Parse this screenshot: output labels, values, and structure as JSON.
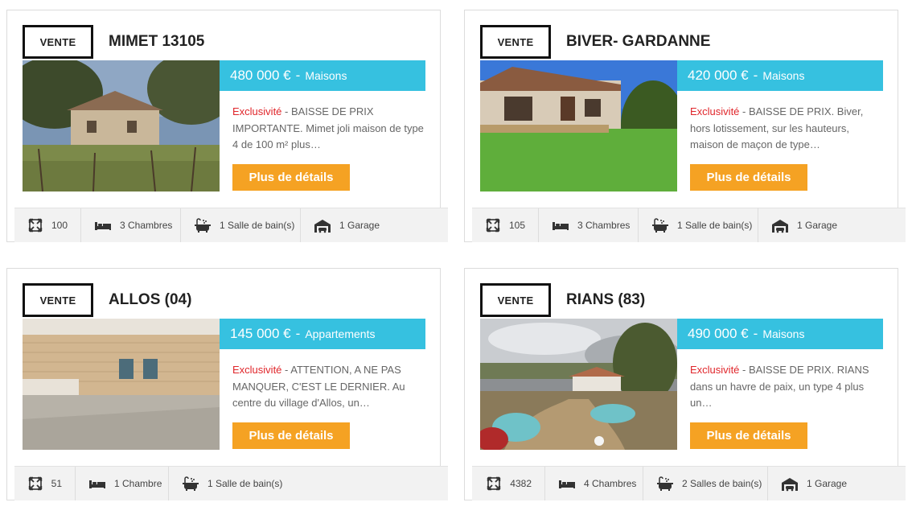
{
  "colors": {
    "accent_blue": "#36c1e0",
    "button_orange": "#f5a223",
    "exclusive_red": "#e0262b"
  },
  "listings": [
    {
      "badge": "VENTE",
      "title": "MIMET 13105",
      "price": "480 000 €",
      "separator": "-",
      "property_type": "Maisons",
      "exclusive_label": "Exclusivité",
      "description": " - BAISSE DE PRIX IMPORTANTE. Mimet joli maison de type 4 de 100 m² plus…",
      "button_label": "Plus de détails",
      "features": {
        "surface": "100",
        "bedrooms": "3 Chambres",
        "bathrooms": "1 Salle de bain(s)",
        "garage": "1 Garage"
      }
    },
    {
      "badge": "VENTE",
      "title": "BIVER- GARDANNE",
      "price": "420 000 €",
      "separator": "-",
      "property_type": "Maisons",
      "exclusive_label": "Exclusivité",
      "description": " - BAISSE DE PRIX. Biver, hors lotissement, sur les hauteurs, maison de maçon de type…",
      "button_label": "Plus de détails",
      "features": {
        "surface": "105",
        "bedrooms": "3 Chambres",
        "bathrooms": "1 Salle de bain(s)",
        "garage": "1 Garage"
      }
    },
    {
      "badge": "VENTE",
      "title": "ALLOS (04)",
      "price": "145 000 €",
      "separator": "-",
      "property_type": "Appartements",
      "exclusive_label": "Exclusivité",
      "description": " - ATTENTION, A NE PAS MANQUER, C'EST LE DERNIER. Au centre du village d'Allos, un…",
      "button_label": "Plus de détails",
      "features": {
        "surface": "51",
        "bedrooms": "1 Chambre",
        "bathrooms": "1 Salle de bain(s)"
      }
    },
    {
      "badge": "VENTE",
      "title": "RIANS (83)",
      "price": "490 000 €",
      "separator": "-",
      "property_type": "Maisons",
      "exclusive_label": "Exclusivité",
      "description": " - BAISSE DE PRIX. RIANS dans un havre de paix, un type 4 plus un…",
      "button_label": "Plus de détails",
      "features": {
        "surface": "4382",
        "bedrooms": "4 Chambres",
        "bathrooms": "2 Salles de bain(s)",
        "garage": "1 Garage"
      }
    }
  ]
}
